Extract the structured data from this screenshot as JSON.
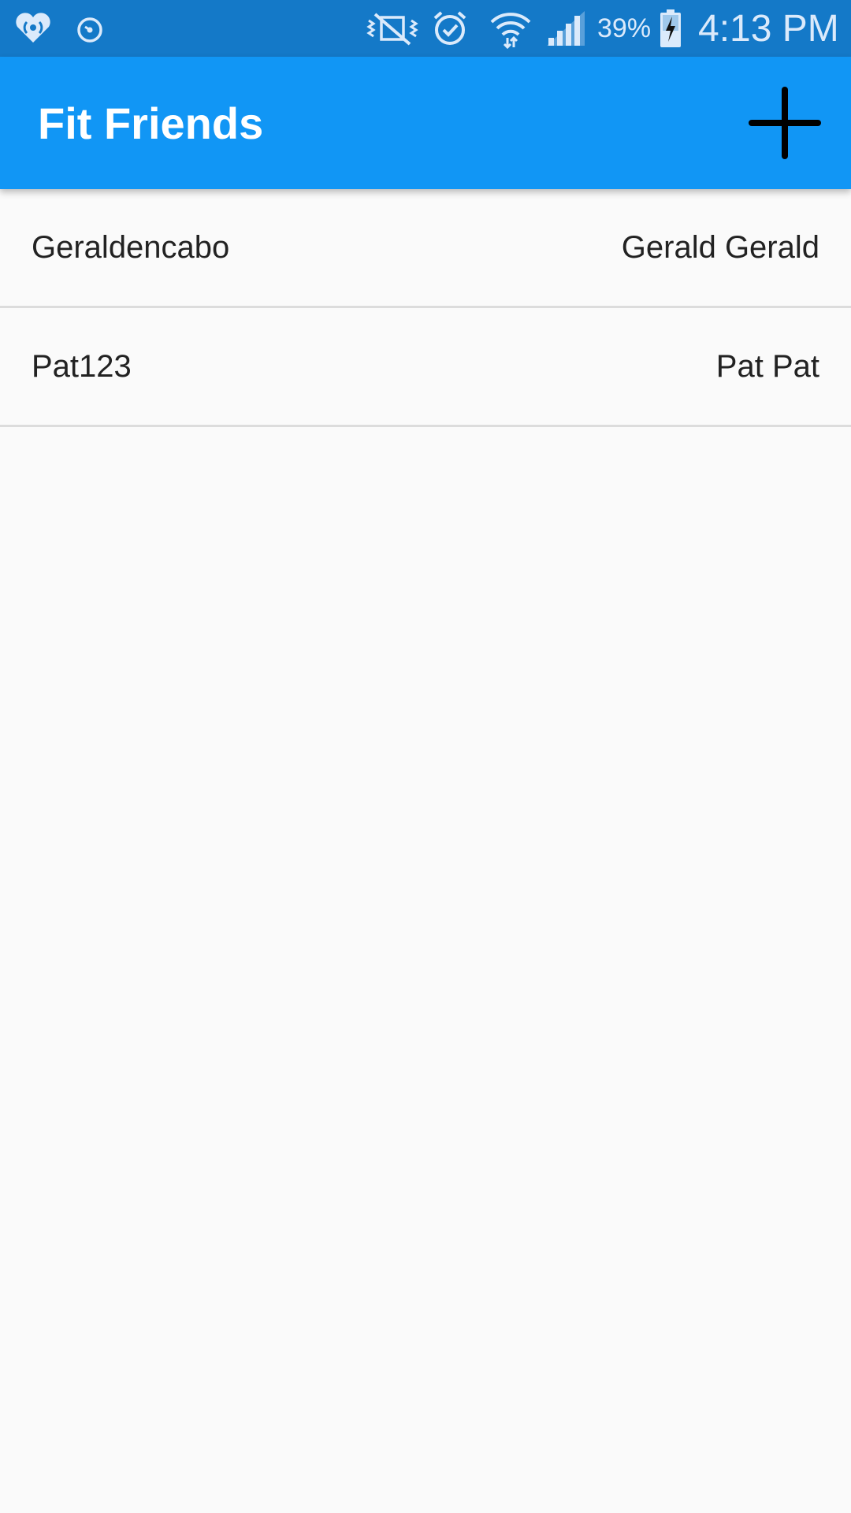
{
  "status_bar": {
    "battery_percent": "39%",
    "time": "4:13 PM",
    "icons": [
      "iheart-radio-icon",
      "alarm-icon",
      "mute-vibrate-icon",
      "alarm-clock-icon",
      "wifi-icon",
      "signal-icon",
      "battery-charging-icon"
    ]
  },
  "app_bar": {
    "title": "Fit Friends",
    "add_icon": "plus-icon"
  },
  "friends": [
    {
      "username": "Geraldencabo",
      "full_name": "Gerald Gerald"
    },
    {
      "username": "Pat123",
      "full_name": "Pat Pat"
    }
  ],
  "colors": {
    "status_bar": "#1479c8",
    "app_bar": "#1196f5",
    "background": "#fafafa",
    "divider": "#dcdcdc",
    "text": "#222222"
  }
}
